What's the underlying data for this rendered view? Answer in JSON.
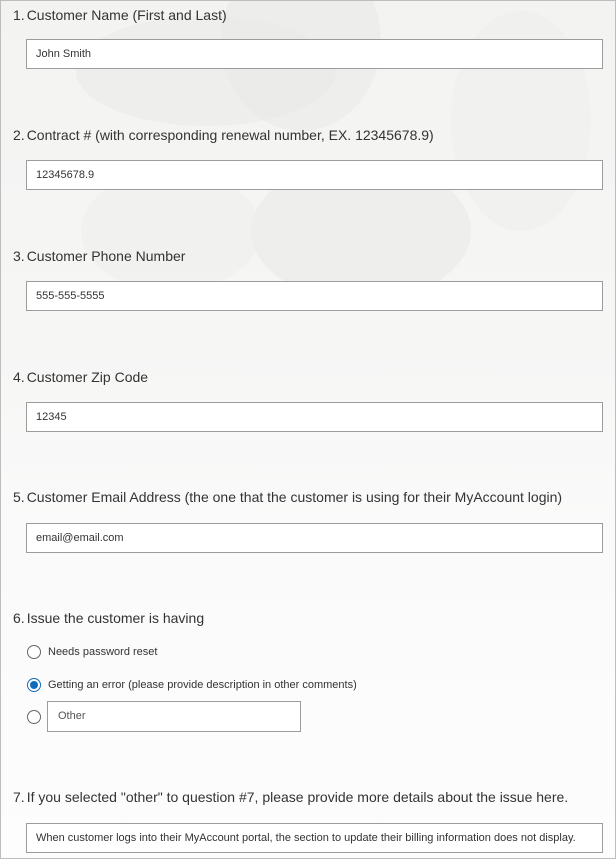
{
  "questions": [
    {
      "number": "1.",
      "title": "Customer Name (First and Last)",
      "value": "John Smith"
    },
    {
      "number": "2.",
      "title": "Contract # (with corresponding renewal number, EX. 12345678.9)",
      "value": "12345678.9"
    },
    {
      "number": "3.",
      "title": "Customer Phone Number",
      "value": "555-555-5555"
    },
    {
      "number": "4.",
      "title": "Customer Zip Code",
      "value": "12345"
    },
    {
      "number": "5.",
      "title": "Customer Email Address (the one that the customer is using for their MyAccount login)",
      "value": "email@email.com"
    },
    {
      "number": "6.",
      "title": "Issue the customer is having",
      "options": [
        {
          "label": "Needs password reset",
          "selected": false
        },
        {
          "label": "Getting an error (please provide description in other comments)",
          "selected": true
        }
      ],
      "other_placeholder": "Other"
    },
    {
      "number": "7.",
      "title": "If you selected \"other\" to question #7, please provide more details about the issue here.",
      "value": "When customer logs into their MyAccount portal, the section to update their billing information does not display."
    }
  ],
  "colors": {
    "accent": "#0f6cbd",
    "field_border": "#9c9c9c"
  }
}
